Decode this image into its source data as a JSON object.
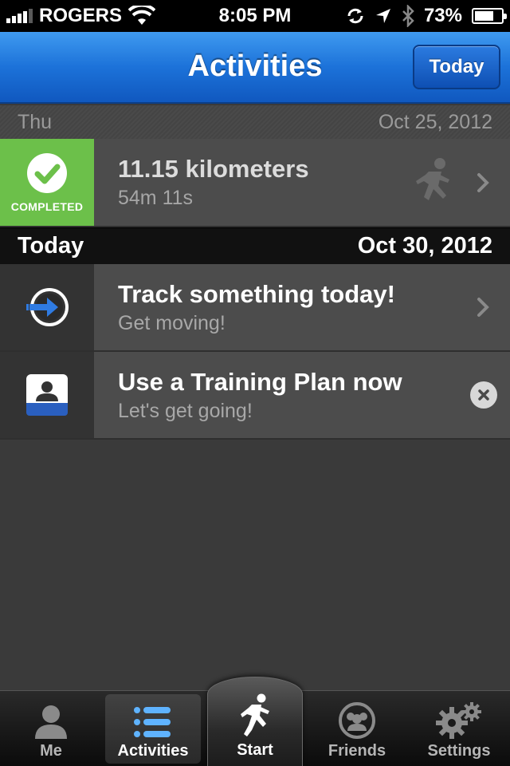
{
  "status_bar": {
    "carrier": "ROGERS",
    "time": "8:05 PM",
    "battery": "73%",
    "battery_level": 0.73
  },
  "nav": {
    "title": "Activities",
    "today_button": "Today"
  },
  "sections": [
    {
      "day": "Thu",
      "date": "Oct 25, 2012"
    },
    {
      "day": "Today",
      "date": "Oct 30, 2012"
    }
  ],
  "activity": {
    "status": "COMPLETED",
    "distance": "11.15 kilometers",
    "duration": "54m 11s",
    "icon": "runner-icon"
  },
  "suggestions": [
    {
      "title": "Track something today!",
      "subtitle": "Get moving!",
      "icon": "track-arrow-icon"
    },
    {
      "title": "Use a Training Plan now",
      "subtitle": "Let's get going!",
      "icon": "training-plan-icon"
    }
  ],
  "tabs": [
    {
      "label": "Me",
      "icon": "person-icon"
    },
    {
      "label": "Activities",
      "icon": "list-icon",
      "active": true
    },
    {
      "label": "Start",
      "icon": "runner-icon"
    },
    {
      "label": "Friends",
      "icon": "friends-icon"
    },
    {
      "label": "Settings",
      "icon": "gear-icon"
    }
  ],
  "colors": {
    "nav_blue": "#1c72d9",
    "completed_green": "#6cc04a",
    "background": "#3a3a3a"
  }
}
